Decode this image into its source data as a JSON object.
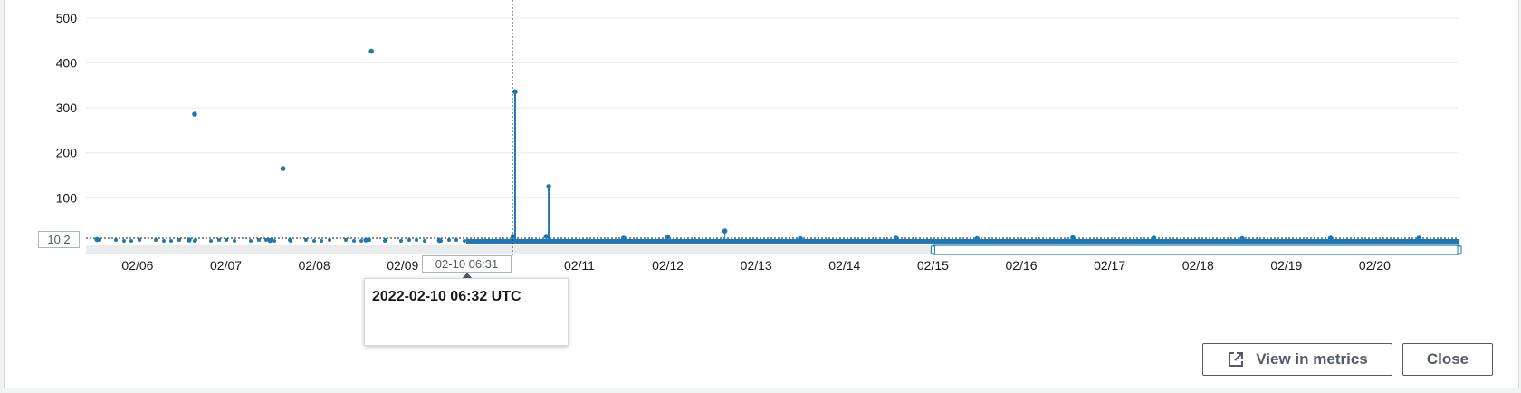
{
  "chart_data": {
    "type": "scatter",
    "title": "",
    "xlabel": "",
    "ylabel": "",
    "ylim": [
      0,
      540
    ],
    "yticks": [
      100,
      200,
      300,
      400,
      500
    ],
    "xlim": [
      "2022-02-05 10:00",
      "2022-02-20 23:00"
    ],
    "xticks": [
      "02/06",
      "02/07",
      "02/08",
      "02/09",
      "02/10",
      "02/11",
      "02/12",
      "02/13",
      "02/14",
      "02/15",
      "02/16",
      "02/17",
      "02/18",
      "02/19",
      "02/20"
    ],
    "grid": true,
    "series": [
      {
        "color": "#1f77b4",
        "points": [
          [
            "2022-02-06 15:30",
            286
          ],
          [
            "2022-02-07 15:30",
            165
          ],
          [
            "2022-02-08 15:30",
            426
          ],
          [
            "2022-02-10 06:32",
            336
          ],
          [
            "2022-02-10 15:40",
            125
          ],
          [
            "2022-02-12 15:30",
            26
          ],
          [
            "2022-02-05 13:00",
            7
          ],
          [
            "2022-02-06 14:00",
            6
          ],
          [
            "2022-02-07 12:00",
            5
          ],
          [
            "2022-02-08 14:00",
            6
          ],
          [
            "2022-02-09 10:00",
            5
          ],
          [
            "2022-02-10 06:00",
            14
          ],
          [
            "2022-02-10 15:00",
            14
          ],
          [
            "2022-02-11 12:00",
            10
          ],
          [
            "2022-02-12 00:00",
            12
          ],
          [
            "2022-02-13 12:00",
            9
          ],
          [
            "2022-02-14 14:00",
            10
          ],
          [
            "2022-02-15 12:00",
            9
          ],
          [
            "2022-02-16 14:00",
            11
          ],
          [
            "2022-02-17 12:00",
            10
          ],
          [
            "2022-02-18 12:00",
            9
          ],
          [
            "2022-02-19 12:00",
            10
          ],
          [
            "2022-02-20 12:00",
            10
          ]
        ]
      }
    ],
    "reference_value": 10.2,
    "hover": {
      "x_label": "02-10 06:31",
      "y_label": "10.2",
      "tooltip_title": "2022-02-10 06:32 UTC"
    }
  },
  "buttons": {
    "view_in_metrics": "View in metrics",
    "close": "Close"
  },
  "colors": {
    "series": "#1f77b4",
    "grid": "#e9ebed",
    "button_border": "#545b64"
  }
}
